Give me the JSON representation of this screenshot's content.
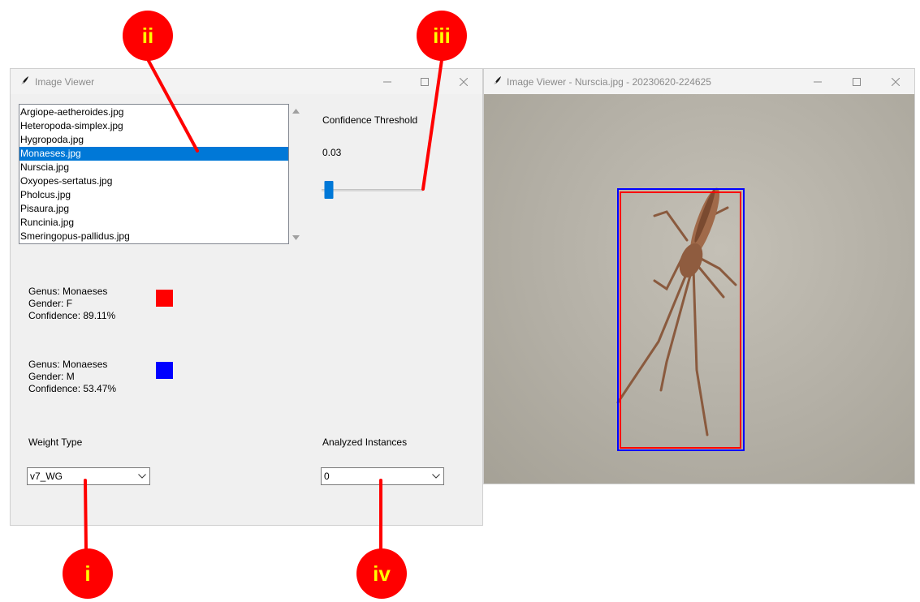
{
  "left_window": {
    "title": "Image Viewer",
    "files": [
      "Argiope-aetheroides.jpg",
      "Heteropoda-simplex.jpg",
      "Hygropoda.jpg",
      "Monaeses.jpg",
      "Nurscia.jpg",
      "Oxyopes-sertatus.jpg",
      "Pholcus.jpg",
      "Pisaura.jpg",
      "Runcinia.jpg",
      "Smeringopus-pallidus.jpg"
    ],
    "selected_file_index": 3,
    "confidence_label": "Confidence Threshold",
    "confidence_value": "0.03",
    "confidence_slider_fraction": 0.03,
    "detections": [
      {
        "genus": "Genus: Monaeses",
        "gender": "Gender: F",
        "confidence": "Confidence: 89.11%",
        "color": "#ff0000"
      },
      {
        "genus": "Genus: Monaeses",
        "gender": "Gender: M",
        "confidence": "Confidence: 53.47%",
        "color": "#0000ff"
      }
    ],
    "weight_type_label": "Weight Type",
    "weight_type_value": "v7_WG",
    "analyzed_label": "Analyzed Instances",
    "analyzed_value": "0"
  },
  "right_window": {
    "title": "Image Viewer - Nurscia.jpg - 20230620-224625",
    "image_subject": "spider-photo",
    "box_colors": [
      "#0000ff",
      "#ff0000"
    ]
  },
  "callouts": {
    "i": "i",
    "ii": "ii",
    "iii": "iii",
    "iv": "iv"
  },
  "colors": {
    "accent": "#0078d7",
    "callout_fill": "#ff0000",
    "callout_text": "#ffff00"
  }
}
